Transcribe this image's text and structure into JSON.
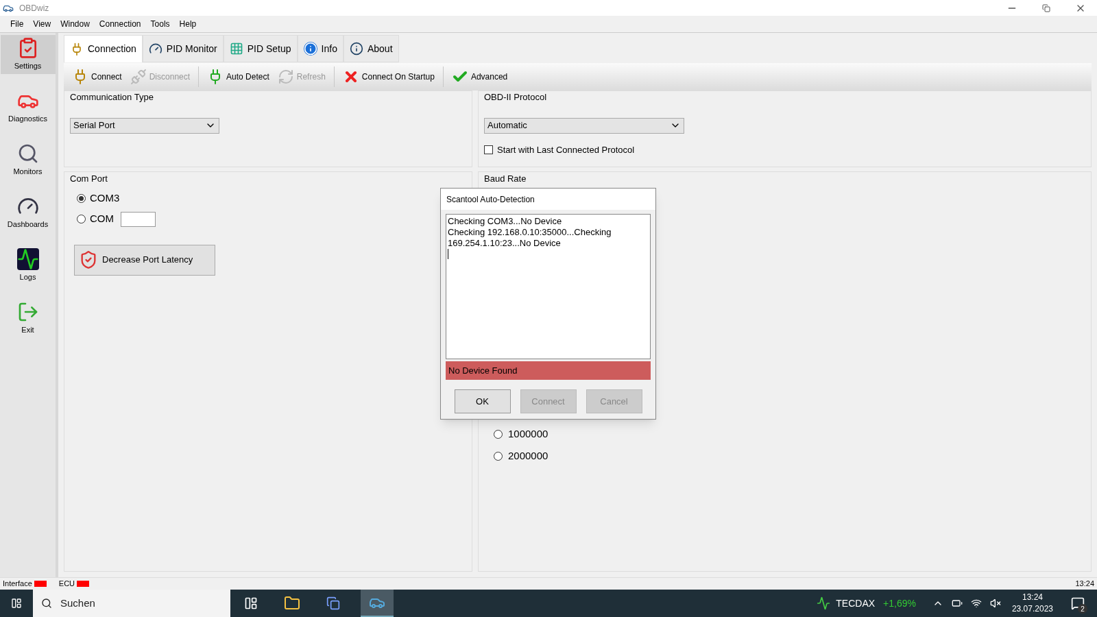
{
  "window": {
    "title": "OBDwiz"
  },
  "menu": [
    "File",
    "View",
    "Window",
    "Connection",
    "Tools",
    "Help"
  ],
  "sidebar": {
    "items": [
      {
        "label": "Settings",
        "selected": true
      },
      {
        "label": "Diagnostics",
        "selected": false
      },
      {
        "label": "Monitors",
        "selected": false
      },
      {
        "label": "Dashboards",
        "selected": false
      },
      {
        "label": "Logs",
        "selected": false
      },
      {
        "label": "Exit",
        "selected": false
      }
    ]
  },
  "tabs": [
    {
      "label": "Connection",
      "selected": true
    },
    {
      "label": "PID Monitor",
      "selected": false
    },
    {
      "label": "PID Setup",
      "selected": false
    },
    {
      "label": "Info",
      "selected": false
    },
    {
      "label": "About",
      "selected": false
    }
  ],
  "toolbar": [
    {
      "label": "Connect",
      "disabled": false
    },
    {
      "label": "Disconnect",
      "disabled": true
    },
    {
      "label": "Auto Detect",
      "disabled": false
    },
    {
      "label": "Refresh",
      "disabled": true
    },
    {
      "label": "Connect On Startup",
      "disabled": false
    },
    {
      "label": "Advanced",
      "disabled": false
    }
  ],
  "communication_type": {
    "title": "Communication Type",
    "value": "Serial Port"
  },
  "com_port": {
    "title": "Com Port",
    "options": [
      {
        "label": "COM3",
        "selected": true,
        "kind": "plain"
      },
      {
        "label": "COM",
        "selected": false,
        "kind": "input"
      }
    ],
    "button": "Decrease Port Latency"
  },
  "obd_protocol": {
    "title": "OBD-II Protocol",
    "value": "Automatic",
    "checkbox": {
      "label": "Start with Last Connected Protocol",
      "checked": false
    }
  },
  "baud_rate": {
    "title": "Baud Rate",
    "options": [
      {
        "label": "1000000",
        "selected": false
      },
      {
        "label": "2000000",
        "selected": false
      }
    ]
  },
  "dialog": {
    "title": "Scantool Auto-Detection",
    "log": [
      "Checking COM3...No Device",
      "Checking 192.168.0.10:35000...Checking",
      "169.254.1.10:23...No Device"
    ],
    "status": "No Device Found",
    "buttons": [
      {
        "label": "OK",
        "disabled": false
      },
      {
        "label": "Connect",
        "disabled": true
      },
      {
        "label": "Cancel",
        "disabled": true
      }
    ]
  },
  "status_bar": {
    "indicators": [
      {
        "label": "Interface",
        "color": "#ff0000"
      },
      {
        "label": "ECU",
        "color": "#ff0000"
      }
    ],
    "time": "13:24"
  },
  "taskbar": {
    "search": "Suchen",
    "ticker": "TECDAX",
    "change": "+1,69%",
    "time": "13:24",
    "date": "23.07.2023",
    "notifications": "2"
  }
}
